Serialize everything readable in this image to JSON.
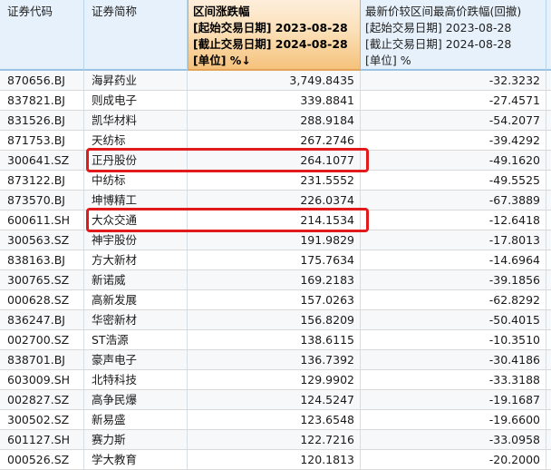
{
  "table": {
    "columns": {
      "code": {
        "label": "证券代码"
      },
      "name": {
        "label": "证券简称"
      },
      "interval_change": {
        "label_lines": [
          "区间涨跌幅",
          "[起始交易日期] 2023-08-28",
          "[截止交易日期] 2024-08-28",
          "[单位] %"
        ],
        "sort_icon": "↓",
        "sorted": "descending",
        "highlighted_column": true
      },
      "drawdown": {
        "label_lines": [
          "最新价较区间最高价跌幅(回撤)",
          "[起始交易日期] 2023-08-28",
          "[截止交易日期] 2024-08-28",
          "[单位] %"
        ]
      }
    },
    "rows": [
      {
        "code": "870656.BJ",
        "name": "海昇药业",
        "interval_change": "3,749.8435",
        "drawdown": "-32.3232",
        "highlighted": false
      },
      {
        "code": "837821.BJ",
        "name": "则成电子",
        "interval_change": "339.8841",
        "drawdown": "-27.4571",
        "highlighted": false
      },
      {
        "code": "831526.BJ",
        "name": "凯华材料",
        "interval_change": "288.9184",
        "drawdown": "-54.2077",
        "highlighted": false
      },
      {
        "code": "871753.BJ",
        "name": "天纺标",
        "interval_change": "267.2746",
        "drawdown": "-39.4292",
        "highlighted": false
      },
      {
        "code": "300641.SZ",
        "name": "正丹股份",
        "interval_change": "264.1077",
        "drawdown": "-49.1620",
        "highlighted": true
      },
      {
        "code": "873122.BJ",
        "name": "中纺标",
        "interval_change": "231.5552",
        "drawdown": "-49.5525",
        "highlighted": false
      },
      {
        "code": "873570.BJ",
        "name": "坤博精工",
        "interval_change": "226.0374",
        "drawdown": "-67.3889",
        "highlighted": false
      },
      {
        "code": "600611.SH",
        "name": "大众交通",
        "interval_change": "214.1534",
        "drawdown": "-12.6418",
        "highlighted": true
      },
      {
        "code": "300563.SZ",
        "name": "神宇股份",
        "interval_change": "191.9829",
        "drawdown": "-17.8013",
        "highlighted": false
      },
      {
        "code": "838163.BJ",
        "name": "方大新材",
        "interval_change": "175.7634",
        "drawdown": "-14.6964",
        "highlighted": false
      },
      {
        "code": "300765.SZ",
        "name": "新诺威",
        "interval_change": "169.2183",
        "drawdown": "-39.1856",
        "highlighted": false
      },
      {
        "code": "000628.SZ",
        "name": "高新发展",
        "interval_change": "157.0263",
        "drawdown": "-62.8292",
        "highlighted": false
      },
      {
        "code": "836247.BJ",
        "name": "华密新材",
        "interval_change": "156.8209",
        "drawdown": "-50.4015",
        "highlighted": false
      },
      {
        "code": "002700.SZ",
        "name": "ST浩源",
        "interval_change": "138.6115",
        "drawdown": "-10.3510",
        "highlighted": false
      },
      {
        "code": "838701.BJ",
        "name": "豪声电子",
        "interval_change": "136.7392",
        "drawdown": "-30.4186",
        "highlighted": false
      },
      {
        "code": "603009.SH",
        "name": "北特科技",
        "interval_change": "129.9902",
        "drawdown": "-33.3188",
        "highlighted": false
      },
      {
        "code": "002827.SZ",
        "name": "高争民爆",
        "interval_change": "124.5247",
        "drawdown": "-19.1687",
        "highlighted": false
      },
      {
        "code": "300502.SZ",
        "name": "新易盛",
        "interval_change": "123.6548",
        "drawdown": "-19.6600",
        "highlighted": false
      },
      {
        "code": "601127.SH",
        "name": "赛力斯",
        "interval_change": "122.7216",
        "drawdown": "-33.0958",
        "highlighted": false
      },
      {
        "code": "000526.SZ",
        "name": "学大教育",
        "interval_change": "120.1813",
        "drawdown": "-20.2000",
        "highlighted": false
      }
    ]
  },
  "colors": {
    "header_bg": "#e7f1fb",
    "sorted_header_gradient_top": "#fdeedb",
    "sorted_header_gradient_bottom": "#f5c27c",
    "row_alt_bg": "#f7f8fa",
    "grid_line": "#d9d9d9",
    "highlight_box_border": "#e11b1b"
  }
}
